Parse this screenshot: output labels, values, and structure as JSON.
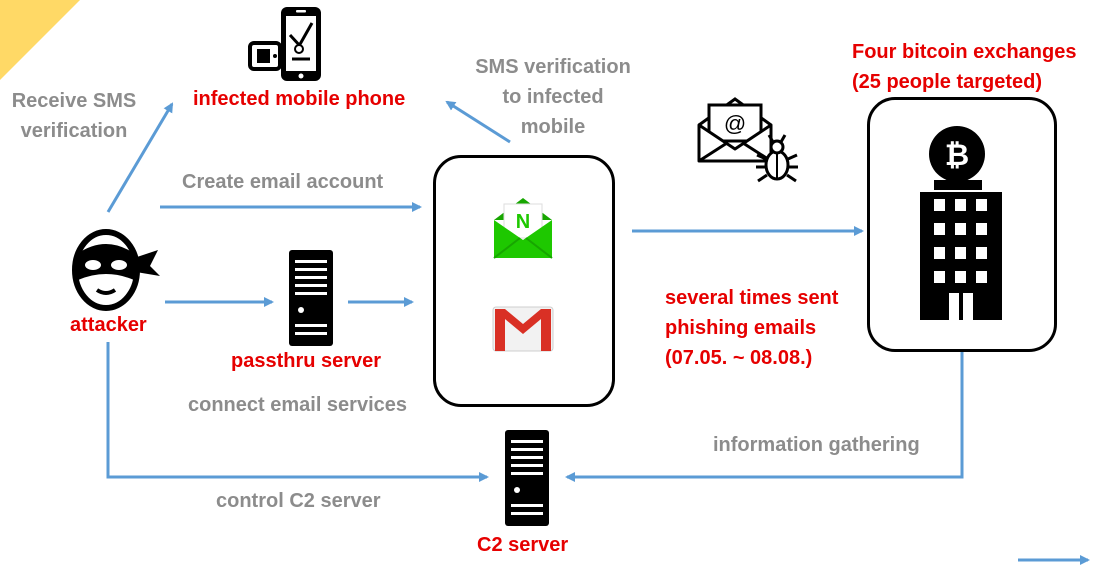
{
  "labels": {
    "receive_sms_line1": "Receive SMS",
    "receive_sms_line2": "verification",
    "infected_phone": "infected mobile phone",
    "sms_to_mobile_line1": "SMS verification",
    "sms_to_mobile_line2": "to infected",
    "sms_to_mobile_line3": "mobile",
    "create_email": "Create email account",
    "attacker": "attacker",
    "passthru": "passthru server",
    "connect_email": "connect email services",
    "control_c2": "control C2 server",
    "c2_server": "C2 server",
    "exchanges_line1": "Four bitcoin exchanges",
    "exchanges_line2": "(25 people targeted)",
    "phishing_line1": "several times sent",
    "phishing_line2": "phishing emails",
    "phishing_line3": "(07.05. ~ 08.08.)",
    "info_gathering": "information gathering"
  },
  "icons": {
    "naver_letter": "N",
    "bitcoin_symbol": "₿",
    "email_at": "@"
  },
  "colors": {
    "arrow": "#5b9bd5",
    "highlight": "#e60000",
    "muted": "#8c8c8c",
    "naver_green": "#1ec800",
    "gmail_red": "#d93025",
    "corner_accent": "#ffd966"
  }
}
